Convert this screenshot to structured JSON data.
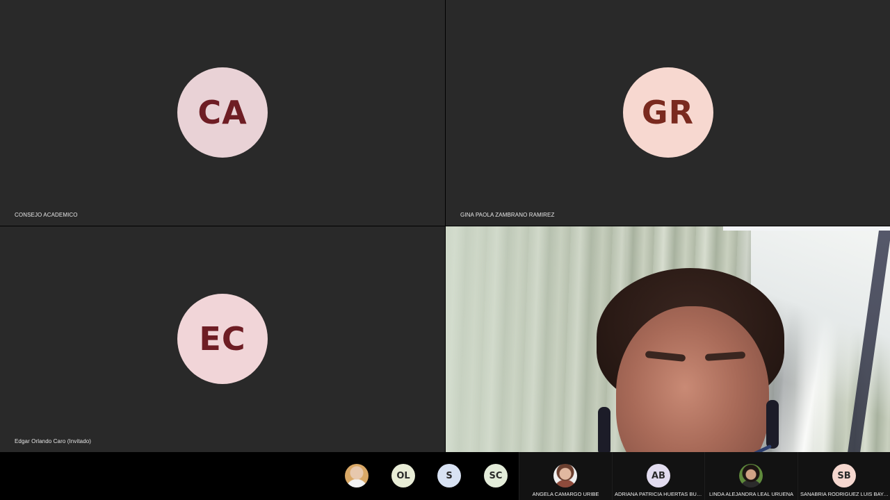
{
  "tiles": [
    {
      "initials": "CA",
      "name": "CONSEJO ACADEMICO",
      "avatar_bg": "#e9d2d6",
      "avatar_fg": "#6e1d24"
    },
    {
      "initials": "GR",
      "name": "GINA PAOLA ZAMBRANO RAMIREZ",
      "avatar_bg": "#f7d8d0",
      "avatar_fg": "#7a2a1f"
    },
    {
      "initials": "EC",
      "name": "Edgar Orlando Caro (Invitado)",
      "avatar_bg": "#f1d5d8",
      "avatar_fg": "#6e1d24"
    },
    {
      "type": "video-feed"
    }
  ],
  "strip": {
    "small_avatars": [
      {
        "kind": "photo",
        "icon": "person-photo-icon"
      },
      {
        "initials": "OL",
        "bg": "#e8ecd6"
      },
      {
        "initials": "S",
        "bg": "#d8e2f3"
      },
      {
        "initials": "SC",
        "bg": "#e3ecd9"
      }
    ],
    "panel_participants": [
      {
        "kind": "photo",
        "name": "ANGELA CAMARGO URIBE"
      },
      {
        "initials": "AB",
        "name": "ADRIANA PATRICIA HUERTAS BUST...",
        "bg": "#e2dcef"
      },
      {
        "kind": "photo",
        "name": "LINDA ALEJANDRA LEAL URUENA"
      },
      {
        "initials": "SB",
        "name": "SANABRIA RODRIGUEZ LUIS BAYAR...",
        "bg": "#f5d7cf"
      }
    ]
  }
}
